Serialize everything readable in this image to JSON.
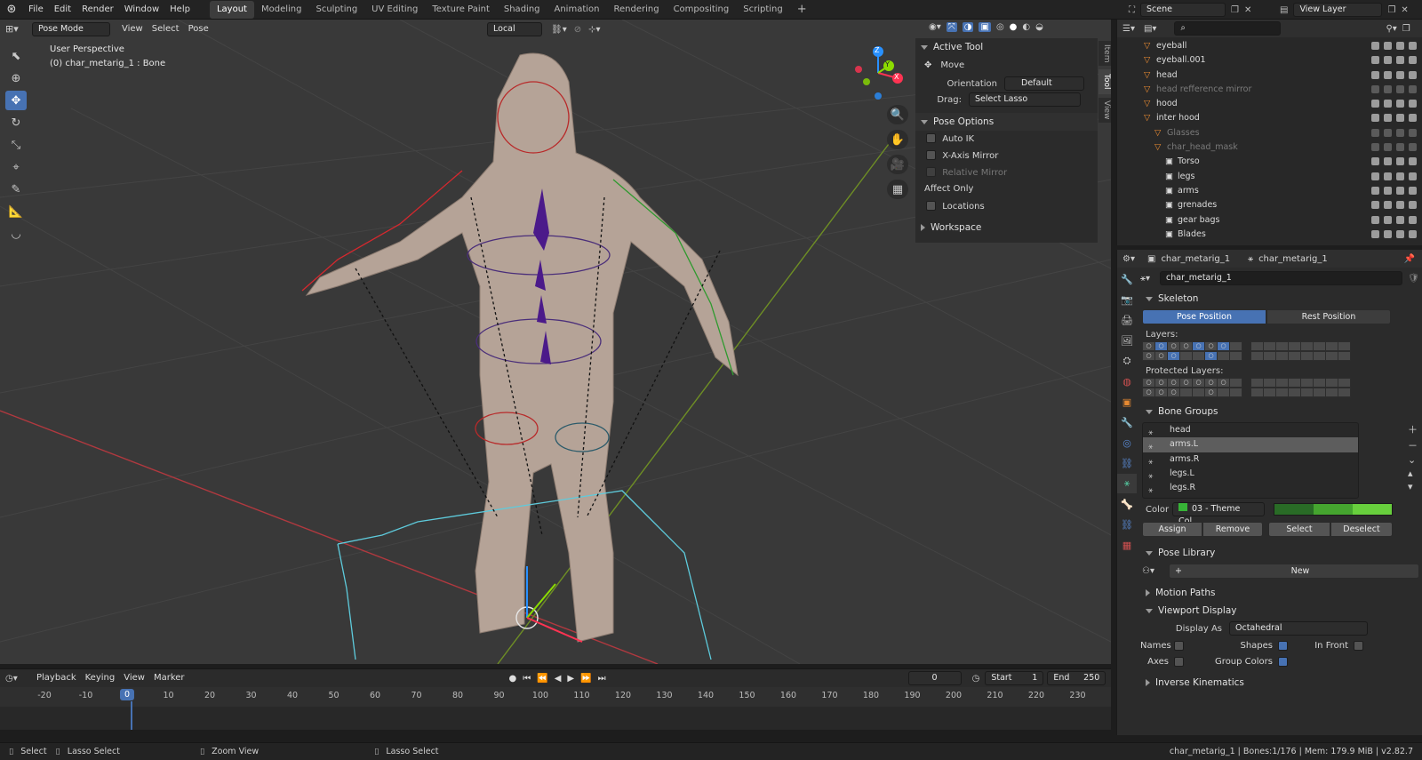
{
  "topbar": {
    "menus": [
      "File",
      "Edit",
      "Render",
      "Window",
      "Help"
    ],
    "workspaces": [
      "Layout",
      "Modeling",
      "Sculpting",
      "UV Editing",
      "Texture Paint",
      "Shading",
      "Animation",
      "Rendering",
      "Compositing",
      "Scripting"
    ],
    "active_workspace": "Layout",
    "add_tab": "+",
    "scene": "Scene",
    "view_layer": "View Layer"
  },
  "viewport_header": {
    "mode": "Pose Mode",
    "menus": [
      "View",
      "Select",
      "Pose"
    ],
    "transform_orientation": "Local"
  },
  "viewport": {
    "perspective_label": "User Perspective",
    "object_label": "(0) char_metarig_1 : Bone",
    "axes": [
      "Z",
      "Y",
      "X"
    ]
  },
  "sidebar_tabs": [
    "Item",
    "Tool",
    "View"
  ],
  "tool_panel": {
    "active_tool_title": "Active Tool",
    "tool_name": "Move",
    "orientation_label": "Orientation",
    "orientation_value": "Default",
    "drag_label": "Drag:",
    "drag_value": "Select Lasso",
    "pose_options_title": "Pose Options",
    "auto_ik": "Auto IK",
    "x_axis_mirror": "X-Axis Mirror",
    "relative_mirror": "Relative Mirror",
    "affect_only": "Affect Only",
    "locations": "Locations",
    "workspace_title": "Workspace"
  },
  "outliner": {
    "search_placeholder": "",
    "rows": [
      {
        "name": "eyeball",
        "dim": false,
        "indent": 44
      },
      {
        "name": "eyeball.001",
        "dim": false,
        "indent": 44
      },
      {
        "name": "head",
        "dim": false,
        "indent": 44
      },
      {
        "name": "head refference mirror",
        "dim": true,
        "indent": 44
      },
      {
        "name": "hood",
        "dim": false,
        "indent": 44
      },
      {
        "name": "inter hood",
        "dim": false,
        "indent": 44
      },
      {
        "name": "Glasses",
        "dim": true,
        "indent": 56
      },
      {
        "name": "char_head_mask",
        "dim": true,
        "indent": 56
      },
      {
        "name": "Torso",
        "dim": false,
        "indent": 68
      },
      {
        "name": "legs",
        "dim": false,
        "indent": 68
      },
      {
        "name": "arms",
        "dim": false,
        "indent": 68
      },
      {
        "name": "grenades",
        "dim": false,
        "indent": 68
      },
      {
        "name": "gear bags",
        "dim": false,
        "indent": 68
      },
      {
        "name": "Blades",
        "dim": false,
        "indent": 68
      }
    ]
  },
  "properties": {
    "breadcrumb_object": "char_metarig_1",
    "breadcrumb_data": "char_metarig_1",
    "data_name": "char_metarig_1",
    "skeleton_title": "Skeleton",
    "pose_position": "Pose Position",
    "rest_position": "Rest Position",
    "layers_label": "Layers:",
    "protected_layers_label": "Protected Layers:",
    "bone_groups_title": "Bone Groups",
    "bone_groups": [
      "head",
      "arms.L",
      "arms.R",
      "legs.L",
      "legs.R"
    ],
    "selected_bone_group": "arms.L",
    "color_label": "Color",
    "color_value": "03 - Theme Col...",
    "assign": "Assign",
    "remove": "Remove",
    "select": "Select",
    "deselect": "Deselect",
    "pose_library_title": "Pose Library",
    "new_button": "New",
    "add_symbol": "+",
    "motion_paths_title": "Motion Paths",
    "viewport_display_title": "Viewport Display",
    "display_as_label": "Display As",
    "display_as_value": "Octahedral",
    "names": "Names",
    "shapes": "Shapes",
    "in_front": "In Front",
    "axes": "Axes",
    "group_colors": "Group Colors",
    "inverse_kinematics_title": "Inverse Kinematics"
  },
  "timeline": {
    "menus": [
      "Playback",
      "Keying",
      "View",
      "Marker"
    ],
    "current_frame": "0",
    "start_label": "Start",
    "start": "1",
    "end_label": "End",
    "end": "250",
    "ticks": [
      "-20",
      "-10",
      "0",
      "10",
      "20",
      "30",
      "40",
      "50",
      "60",
      "70",
      "80",
      "90",
      "100",
      "110",
      "120",
      "130",
      "140",
      "150",
      "160",
      "170",
      "180",
      "190",
      "200",
      "210",
      "220",
      "230"
    ]
  },
  "statusbar": {
    "left_action": "Select",
    "lasso_select": "Lasso Select",
    "zoom_view": "Zoom View",
    "lasso_select_2": "Lasso Select",
    "stats": "char_metarig_1 | Bones:1/176 | Mem: 179.9 MiB | v2.82.7"
  },
  "colors": {
    "accent": "#4772b3",
    "x_axis": "#ff3352",
    "y_axis": "#8bdc00",
    "z_axis": "#2890ff"
  }
}
